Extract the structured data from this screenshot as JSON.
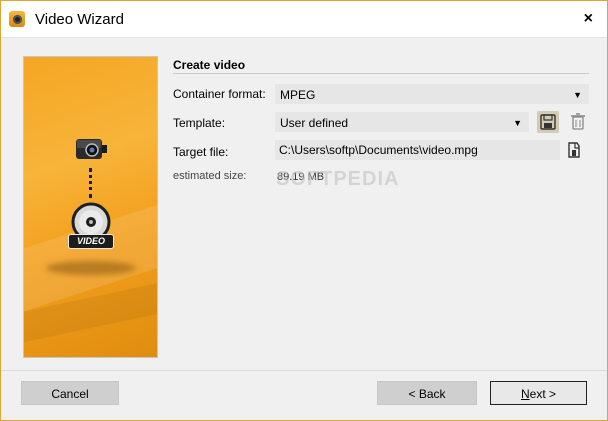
{
  "window": {
    "title": "Video Wizard",
    "close_glyph": "×"
  },
  "illustration": {
    "badge": "VIDEO",
    "icons": [
      "camera-icon",
      "disc-icon"
    ]
  },
  "section": {
    "title": "Create video"
  },
  "form": {
    "container_label": "Container format:",
    "container_value": "MPEG",
    "template_label": "Template:",
    "template_value": "User defined",
    "target_label": "Target file:",
    "target_value": "C:\\Users\\softp\\Documents\\video.mpg",
    "size_label": "estimated size:",
    "size_value": "89.19 MB"
  },
  "watermark": "SOFTPEDIA",
  "buttons": {
    "cancel": "Cancel",
    "back": "< Back",
    "next_mnemonic": "N",
    "next_rest": "ext >"
  },
  "colors": {
    "accent": "#f5a623",
    "window_border": "#d9a833"
  }
}
